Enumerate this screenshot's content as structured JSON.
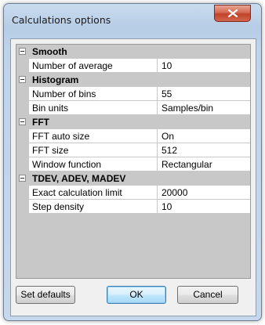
{
  "window": {
    "title": "Calculations options",
    "close_icon": "close-icon"
  },
  "categories": [
    {
      "label": "Smooth",
      "properties": [
        {
          "name": "Number of average",
          "value": "10"
        }
      ]
    },
    {
      "label": "Histogram",
      "properties": [
        {
          "name": "Number of bins",
          "value": "55"
        },
        {
          "name": "Bin units",
          "value": "Samples/bin"
        }
      ]
    },
    {
      "label": "FFT",
      "properties": [
        {
          "name": "FFT auto size",
          "value": "On"
        },
        {
          "name": "FFT size",
          "value": "512"
        },
        {
          "name": "Window function",
          "value": "Rectangular"
        }
      ]
    },
    {
      "label": "TDEV, ADEV, MADEV",
      "properties": [
        {
          "name": "Exact calculation limit",
          "value": "20000"
        },
        {
          "name": "Step density",
          "value": "10"
        }
      ]
    }
  ],
  "buttons": {
    "set_defaults": "Set defaults",
    "ok": "OK",
    "cancel": "Cancel"
  }
}
